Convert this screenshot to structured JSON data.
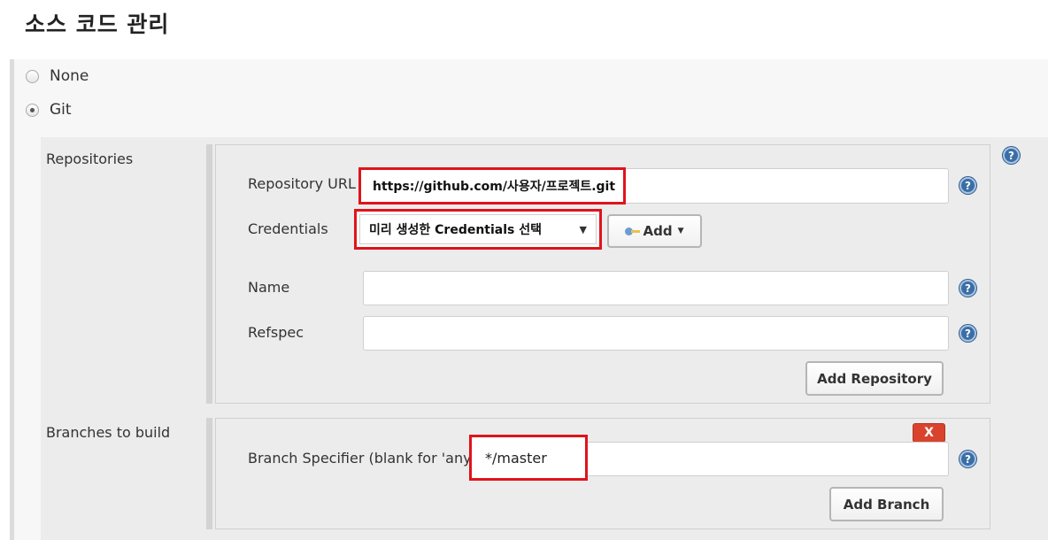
{
  "section_title": "소스 코드 관리",
  "scm": {
    "options": [
      {
        "label": "None",
        "selected": false
      },
      {
        "label": "Git",
        "selected": true
      }
    ]
  },
  "repositories": {
    "label": "Repositories",
    "url_label": "Repository URL",
    "url_value": "https://github.com/사용자/프로젝트.git",
    "credentials_label": "Credentials",
    "credentials_selected": "미리 생성한 Credentials 선택",
    "add_label": "Add",
    "name_label": "Name",
    "name_value": "",
    "refspec_label": "Refspec",
    "refspec_value": "",
    "add_repository_label": "Add Repository"
  },
  "branches": {
    "label": "Branches to build",
    "delete_label": "X",
    "specifier_label": "Branch Specifier (blank for 'any')",
    "specifier_value": "*/master",
    "add_branch_label": "Add Branch"
  },
  "help_glyph": "?",
  "icons": {
    "help": "help-icon",
    "credentials_key": "key-icon",
    "dropdown": "caret-down-icon"
  },
  "colors": {
    "highlight_border": "#e0131b",
    "help_icon": "#3a6ea5",
    "delete_button": "#d9432e"
  }
}
